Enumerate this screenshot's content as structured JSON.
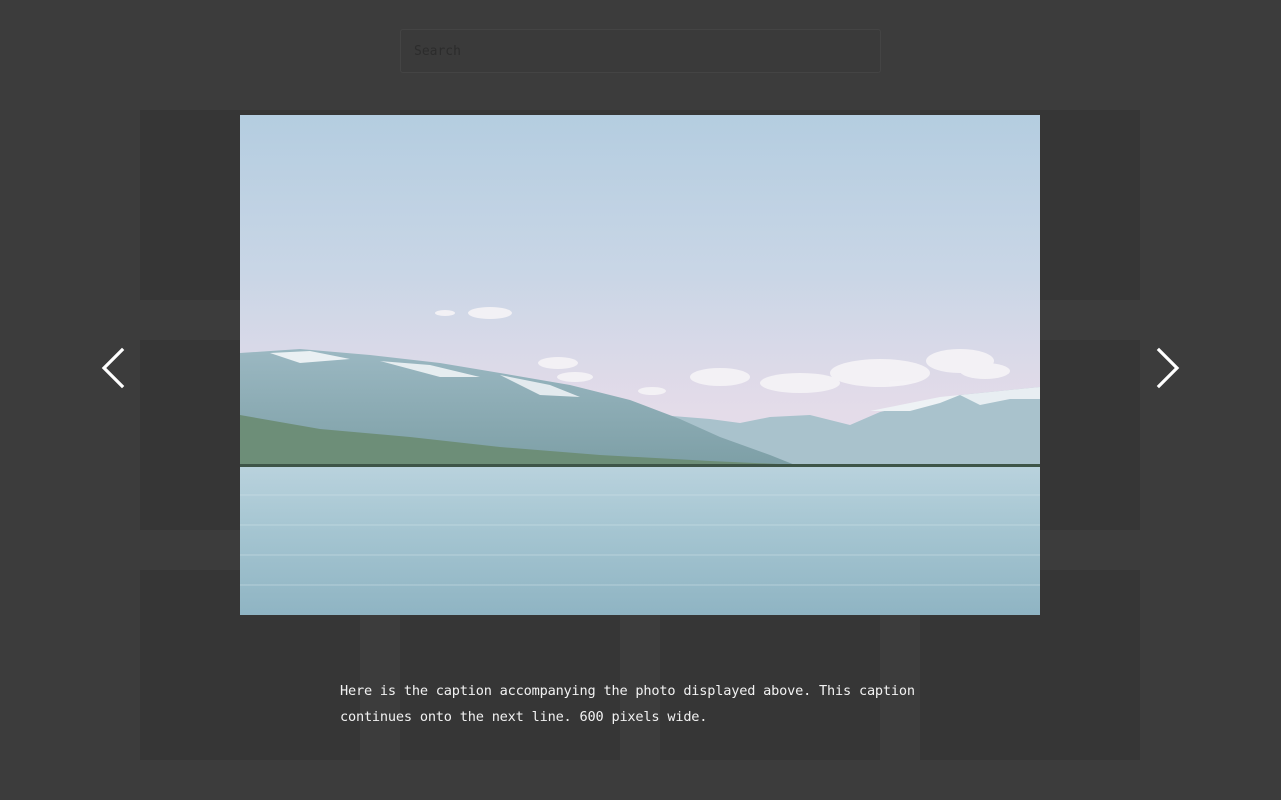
{
  "search": {
    "placeholder": "Search"
  },
  "gallery": {
    "thumbnail_color": "#363636",
    "thumbnail_count": 12
  },
  "lightbox": {
    "image_alt": "Lake with snow-capped mountains under a pale blue sky",
    "caption": "Here is the caption accompanying the photo displayed above. This caption continues onto the next line. 600 pixels wide.",
    "prev_icon": "chevron-left-icon",
    "next_icon": "chevron-right-icon"
  },
  "colors": {
    "backdrop": "#3c3c3c",
    "arrow": "#ffffff",
    "caption_text": "#f2f2f2"
  }
}
